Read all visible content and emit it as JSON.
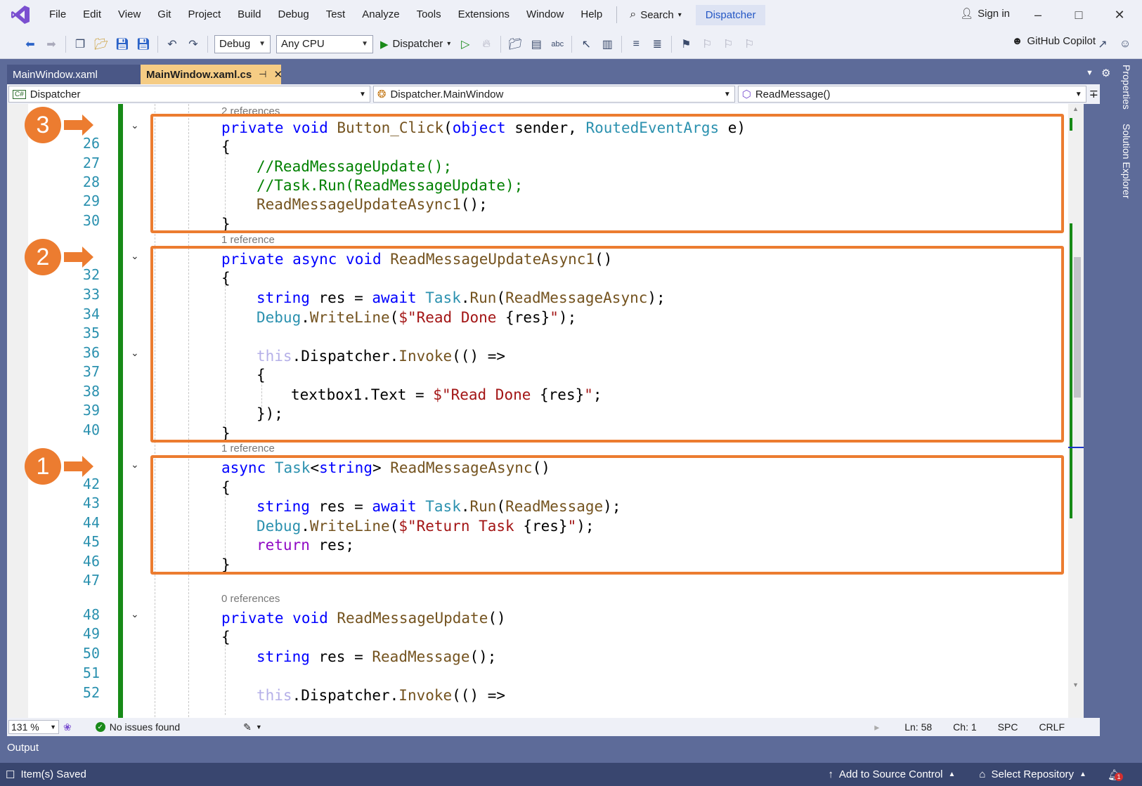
{
  "menu": [
    "File",
    "Edit",
    "View",
    "Git",
    "Project",
    "Build",
    "Debug",
    "Test",
    "Analyze",
    "Tools",
    "Extensions",
    "Window",
    "Help"
  ],
  "search_label": "Search",
  "solution_title": "Dispatcher",
  "sign_in": "Sign in",
  "toolbar": {
    "config": "Debug",
    "platform": "Any CPU",
    "run_target": "Dispatcher",
    "copilot": "GitHub Copilot"
  },
  "tabs": [
    {
      "label": "MainWindow.xaml"
    },
    {
      "label": "MainWindow.xaml.cs"
    }
  ],
  "nav": {
    "project": "Dispatcher",
    "type": "Dispatcher.MainWindow",
    "member": "ReadMessage()"
  },
  "code": {
    "ref_top": "2 references",
    "ref_2": "1 reference",
    "ref_3": "1 reference",
    "ref_4": "0 references",
    "l25a": "private",
    "l25b": "void",
    "l25c": "Button_Click",
    "l25d": "(",
    "l25e": "object",
    "l25f": "sender, ",
    "l25g": "RoutedEventArgs",
    "l25h": " e)",
    "brace_open": "{",
    "brace_close": "}",
    "l27": "//ReadMessageUpdate();",
    "l28": "//Task.Run(ReadMessageUpdate);",
    "l29a": "ReadMessageUpdateAsync1",
    "l29b": "();",
    "l31a": "private",
    "l31b": "async",
    "l31c": "void",
    "l31d": "ReadMessageUpdateAsync1",
    "l31e": "()",
    "l33a": "string",
    "l33b": "res",
    "l33c": " = ",
    "l33d": "await",
    "l33e": "Task",
    "l33f": ".",
    "l33g": "Run",
    "l33h": "(",
    "l33i": "ReadMessageAsync",
    "l33j": ");",
    "l34a": "Debug",
    "l34b": ".",
    "l34c": "WriteLine",
    "l34d": "(",
    "l34e": "$\"Read Done ",
    "l34f": "{res}",
    "l34g": "\"",
    "l34h": ");",
    "l36a": "this",
    "l36b": ".Dispatcher.",
    "l36c": "Invoke",
    "l36d": "(() =>",
    "l38a": "textbox1.Text = ",
    "l38b": "$\"Read Done ",
    "l38c": "{res}",
    "l38d": "\"",
    "l38e": ";",
    "l39": "});",
    "l41a": "async",
    "l41b": "Task",
    "l41c": "<",
    "l41d": "string",
    "l41e": "> ",
    "l41f": "ReadMessageAsync",
    "l41g": "()",
    "l43a": "string",
    "l43b": "res",
    "l43c": " = ",
    "l43d": "await",
    "l43e": "Task",
    "l43f": ".",
    "l43g": "Run",
    "l43h": "(",
    "l43i": "ReadMessage",
    "l43j": ");",
    "l44a": "Debug",
    "l44b": ".",
    "l44c": "WriteLine",
    "l44d": "(",
    "l44e": "$\"Return Task ",
    "l44f": "{res}",
    "l44g": "\"",
    "l44h": ");",
    "l45a": "return",
    "l45b": " res;",
    "l48a": "private",
    "l48b": "void",
    "l48c": "ReadMessageUpdate",
    "l48d": "()",
    "l50a": "string",
    "l50b": "res",
    "l50c": " = ",
    "l50d": "ReadMessage",
    "l50e": "();",
    "l52a": "this",
    "l52b": ".Dispatcher.",
    "l52c": "Invoke",
    "l52d": "(() =>"
  },
  "line_numbers": [
    "26",
    "27",
    "28",
    "29",
    "30",
    "32",
    "33",
    "34",
    "35",
    "36",
    "37",
    "38",
    "39",
    "40",
    "42",
    "43",
    "44",
    "45",
    "46",
    "47",
    "48",
    "49",
    "50",
    "51",
    "52"
  ],
  "markers": [
    "3",
    "2",
    "1"
  ],
  "side_panels": [
    "Properties",
    "Solution Explorer"
  ],
  "editor_status": {
    "zoom": "131 %",
    "issues": "No issues found",
    "line": "Ln: 58",
    "col": "Ch: 1",
    "spc": "SPC",
    "eol": "CRLF"
  },
  "output_label": "Output",
  "status": {
    "saved": "Item(s) Saved",
    "source_control": "Add to Source Control",
    "repo": "Select Repository",
    "notif_count": "1"
  },
  "colors": {
    "accent_orange": "#ec7c30",
    "chrome": "#5d6b99",
    "active_tab": "#f5cc84",
    "change_bar": "#178a17"
  }
}
